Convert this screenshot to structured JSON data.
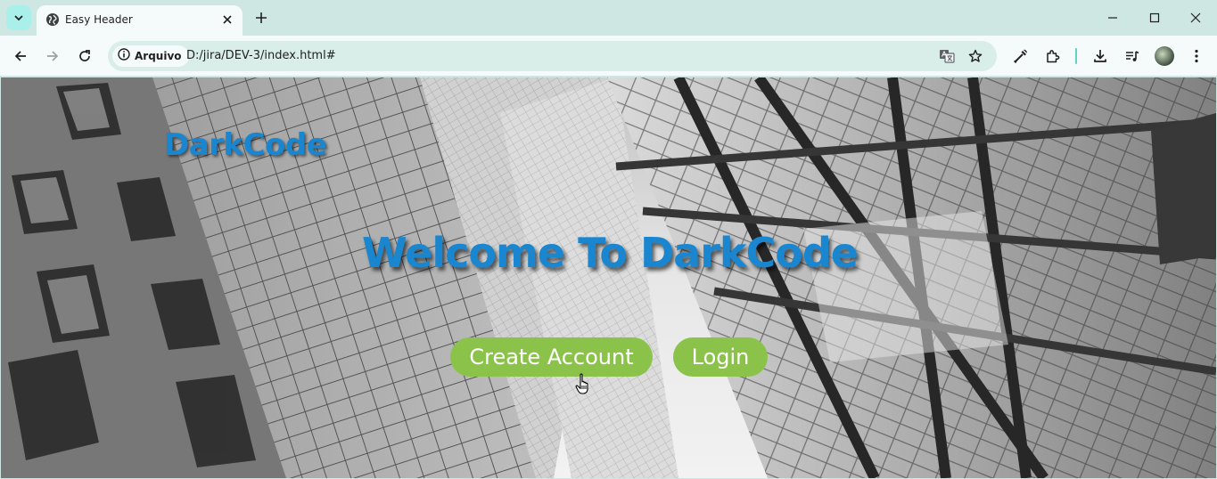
{
  "browser": {
    "tab": {
      "title": "Easy Header"
    },
    "address_bar": {
      "security_label": "Arquivo",
      "url": "D:/jira/DEV-3/index.html#"
    },
    "colors": {
      "frame": "#cfe7e3",
      "toolbar": "#f5fbfa",
      "accent": "#5fd3c7"
    }
  },
  "page": {
    "logo": "DarkCode",
    "hero_title": "Welcome To DarkCode",
    "buttons": {
      "create_account": "Create Account",
      "login": "Login"
    },
    "colors": {
      "brand_blue": "#1b86d0",
      "button_green": "#8bc34a"
    }
  },
  "icons": [
    "tab-search-icon",
    "globe-icon",
    "close-icon",
    "plus-icon",
    "minimize-icon",
    "maximize-icon",
    "window-close-icon",
    "back-icon",
    "forward-icon",
    "reload-icon",
    "info-icon",
    "translate-icon",
    "star-icon",
    "eyedropper-icon",
    "extensions-icon",
    "download-icon",
    "media-icon",
    "menu-icon"
  ]
}
